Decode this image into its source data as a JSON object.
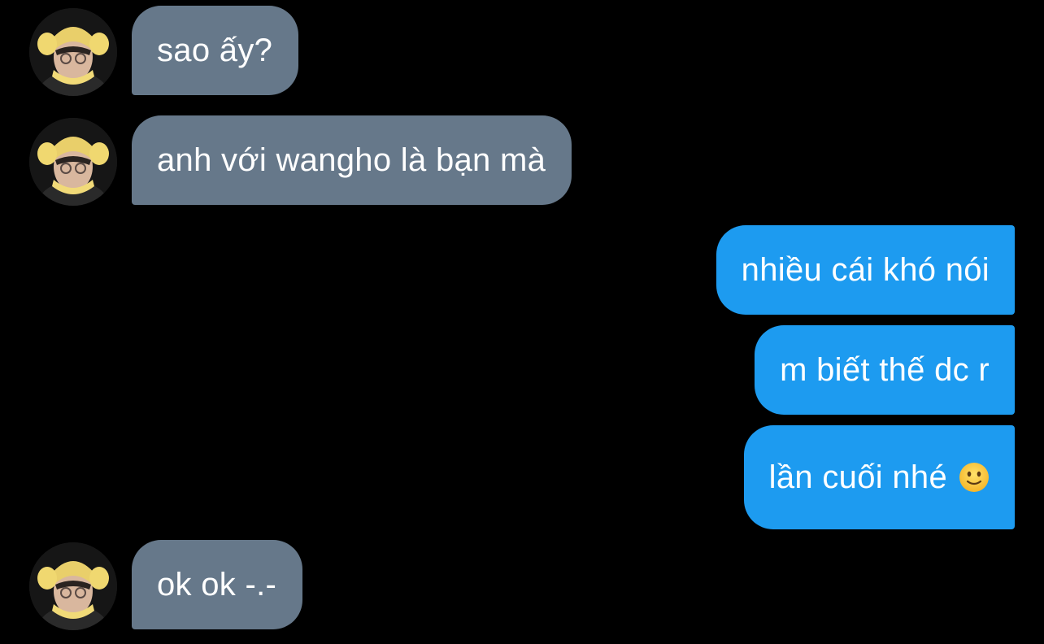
{
  "conversation": {
    "messages": [
      {
        "direction": "incoming",
        "text": "sao ấy?"
      },
      {
        "direction": "incoming",
        "text": "anh với wangho là bạn mà"
      },
      {
        "direction": "outgoing",
        "text": "nhiều cái khó nói"
      },
      {
        "direction": "outgoing",
        "text": "m biết thế dc r"
      },
      {
        "direction": "outgoing",
        "text": "lần cuối nhé",
        "emoji": "slightly-smiling-face-icon"
      },
      {
        "direction": "incoming",
        "text": "ok ok -.-"
      }
    ]
  },
  "colors": {
    "background": "#000000",
    "incoming_bubble": "#66788a",
    "outgoing_bubble": "#1d9bf0",
    "text": "#ffffff"
  }
}
